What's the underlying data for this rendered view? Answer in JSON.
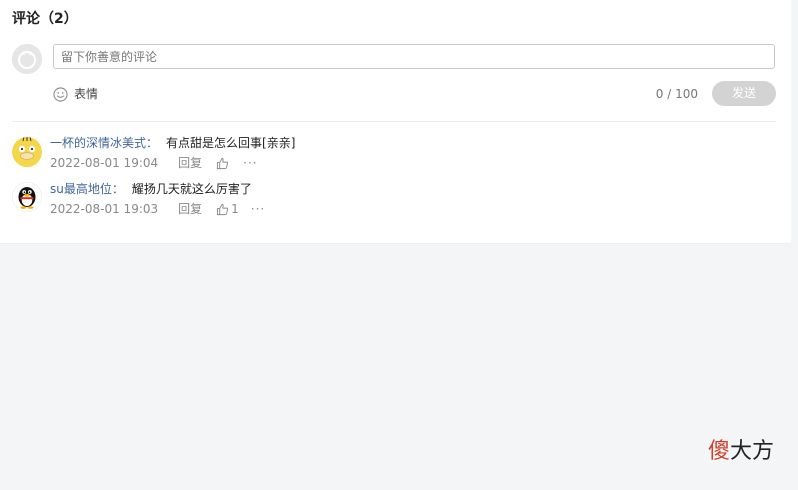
{
  "comments_section": {
    "title": "评论（2）",
    "input": {
      "placeholder": "留下你善意的评论",
      "value": ""
    },
    "emoji_label": "表情",
    "char_counter": "0 / 100",
    "send_label": "发送"
  },
  "comments": [
    {
      "author": "一杯的深情冰美式",
      "separator": "：",
      "text": "有点甜是怎么回事[亲亲]",
      "time": "2022-08-01 19:04",
      "reply_label": "回复",
      "likes": "",
      "more": "···",
      "avatar_icon": "psyduck-avatar-icon"
    },
    {
      "author": "su最高地位",
      "separator": "：",
      "text": "耀扬几天就这么厉害了",
      "time": "2022-08-01 19:03",
      "reply_label": "回复",
      "likes": "1",
      "more": "···",
      "avatar_icon": "penguin-avatar-icon"
    }
  ],
  "watermark": {
    "part1": "傻",
    "part2": "大方"
  },
  "colors": {
    "author": "#406599",
    "send_disabled": "#d3d3d3",
    "page_bg": "#f4f5f7",
    "watermark_accent": "#d0402a"
  }
}
